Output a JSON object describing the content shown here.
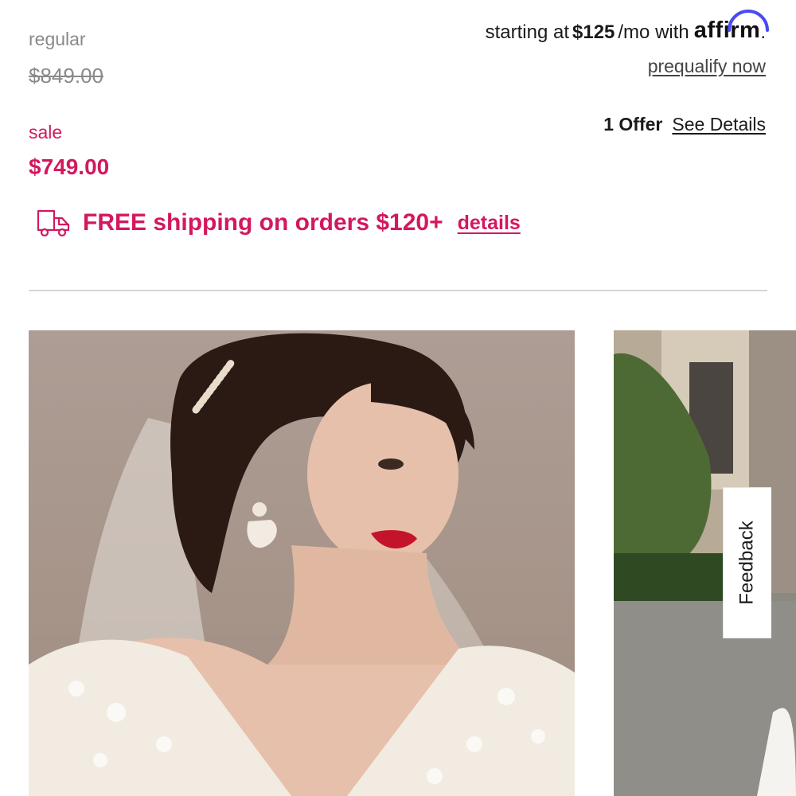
{
  "pricing": {
    "regular_label": "regular",
    "regular_price": "$849.00",
    "sale_label": "sale",
    "sale_price": "$749.00"
  },
  "financing": {
    "prefix": "starting at",
    "amount": "$125",
    "suffix": "/mo with",
    "provider": "affirm",
    "trailing": ".",
    "prequalify_label": "prequalify now"
  },
  "offers": {
    "count_label": "1 Offer",
    "details_label": "See Details"
  },
  "shipping": {
    "icon": "truck-icon",
    "message": "FREE shipping on orders $120+",
    "details_label": "details"
  },
  "feedback": {
    "label": "Feedback"
  },
  "colors": {
    "sale_accent": "#d3185f",
    "affirm_arc": "#4a4af4",
    "muted_text": "#8a8a8a"
  }
}
